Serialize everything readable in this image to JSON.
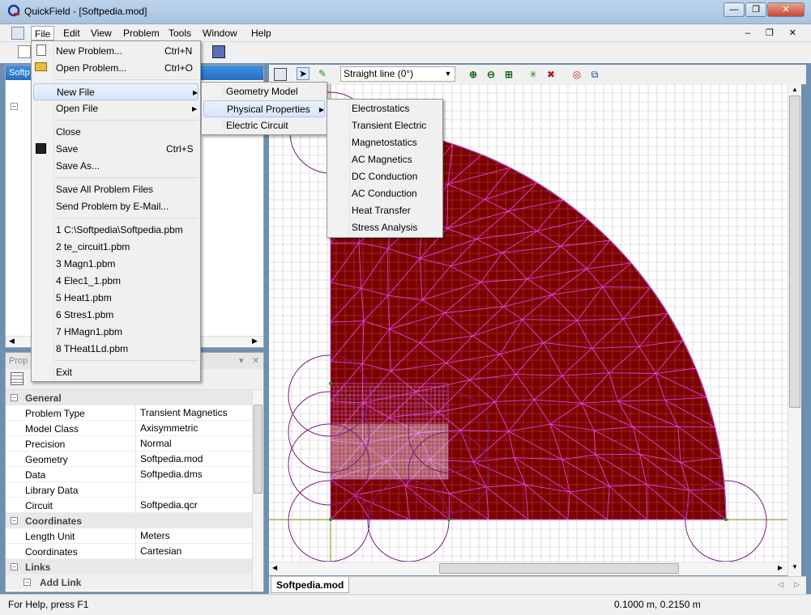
{
  "window": {
    "title": "QuickField - [Softpedia.mod]",
    "min": "—",
    "max": "❐",
    "close": "✕"
  },
  "menubar": [
    "File",
    "Edit",
    "View",
    "Problem",
    "Tools",
    "Window",
    "Help"
  ],
  "mdi_controls": "– ❐ ✕",
  "tree_pane": {
    "title": "Softp"
  },
  "properties": {
    "title": "Prop",
    "categories": [
      {
        "name": "General",
        "rows": [
          {
            "key": "Problem Type",
            "value": "Transient Magnetics"
          },
          {
            "key": "Model Class",
            "value": "Axisymmetric"
          },
          {
            "key": "Precision",
            "value": "Normal"
          },
          {
            "key": "Geometry",
            "value": "Softpedia.mod"
          },
          {
            "key": "Data",
            "value": "Softpedia.dms"
          },
          {
            "key": "Library Data",
            "value": ""
          },
          {
            "key": "Circuit",
            "value": "Softpedia.qcr"
          }
        ]
      },
      {
        "name": "Coordinates",
        "rows": [
          {
            "key": "Length Unit",
            "value": "Meters"
          },
          {
            "key": "Coordinates",
            "value": "Cartesian"
          }
        ]
      },
      {
        "name": "Links",
        "rows": []
      }
    ],
    "add_link": "Add Link"
  },
  "file_menu": {
    "items": [
      {
        "label": "New Problem...",
        "accel": "Ctrl+N"
      },
      {
        "label": "Open Problem...",
        "accel": "Ctrl+O"
      },
      {
        "label": "New File",
        "submenu": true
      },
      {
        "label": "Open File",
        "submenu": true
      },
      {
        "label": "Close"
      },
      {
        "label": "Save",
        "accel": "Ctrl+S"
      },
      {
        "label": "Save As..."
      },
      {
        "label": "Save All Problem Files"
      },
      {
        "label": "Send Problem by E-Mail..."
      },
      {
        "label": "1 C:\\Softpedia\\Softpedia.pbm"
      },
      {
        "label": "2 te_circuit1.pbm"
      },
      {
        "label": "3 Magn1.pbm"
      },
      {
        "label": "4 Elec1_1.pbm"
      },
      {
        "label": "5 Heat1.pbm"
      },
      {
        "label": "6 Stres1.pbm"
      },
      {
        "label": "7 HMagn1.pbm"
      },
      {
        "label": "8 THeat1Ld.pbm"
      },
      {
        "label": "Exit"
      }
    ]
  },
  "new_file_menu": [
    "Geometry Model",
    "Physical Properties",
    "Electric Circuit"
  ],
  "physical_properties_menu": [
    "Electrostatics",
    "Transient Electric",
    "Magnetostatics",
    "AC Magnetics",
    "DC Conduction",
    "AC Conduction",
    "Heat Transfer",
    "Stress Analysis"
  ],
  "draw_toolbar": {
    "line_mode": "Straight line (0°)"
  },
  "doc_tab": "Softpedia.mod",
  "status": {
    "help": "For Help, press F1",
    "coords": "0.1000 m, 0.2150 m"
  },
  "colors": {
    "region_fill": "#7d0000",
    "mesh": "#e040e0",
    "grid": "#c8c8c8"
  }
}
